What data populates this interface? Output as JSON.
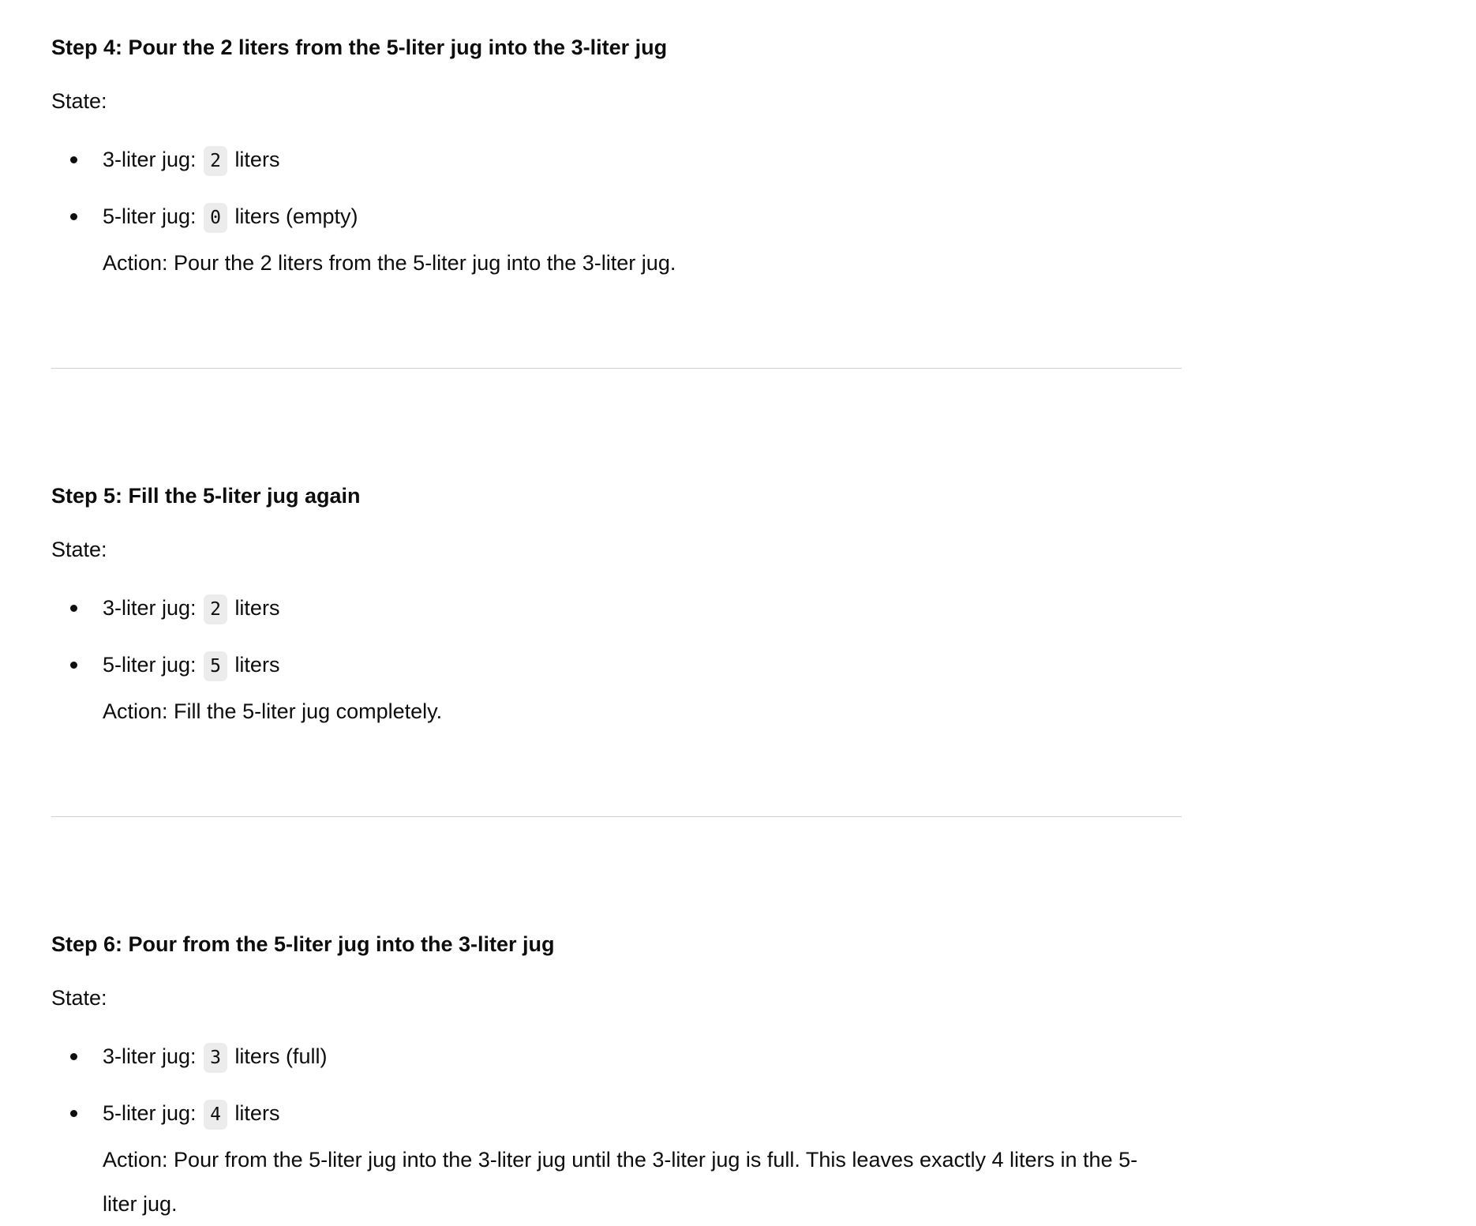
{
  "steps": [
    {
      "title": "Step 4: Pour the 2 liters from the 5-liter jug into the 3-liter jug",
      "state_label": "State:",
      "jugs": [
        {
          "label": "3-liter jug:",
          "value": "2",
          "suffix": "liters"
        },
        {
          "label": "5-liter jug:",
          "value": "0",
          "suffix": "liters (empty)"
        }
      ],
      "action": "Action: Pour the 2 liters from the 5-liter jug into the 3-liter jug."
    },
    {
      "title": "Step 5: Fill the 5-liter jug again",
      "state_label": "State:",
      "jugs": [
        {
          "label": "3-liter jug:",
          "value": "2",
          "suffix": "liters"
        },
        {
          "label": "5-liter jug:",
          "value": "5",
          "suffix": "liters"
        }
      ],
      "action": "Action: Fill the 5-liter jug completely."
    },
    {
      "title": "Step 6: Pour from the 5-liter jug into the 3-liter jug",
      "state_label": "State:",
      "jugs": [
        {
          "label": "3-liter jug:",
          "value": "3",
          "suffix": "liters (full)"
        },
        {
          "label": "5-liter jug:",
          "value": "4",
          "suffix": "liters"
        }
      ],
      "action": "Action: Pour from the 5-liter jug into the 3-liter jug until the 3-liter jug is full. This leaves exactly 4 liters in the 5-liter jug."
    }
  ]
}
